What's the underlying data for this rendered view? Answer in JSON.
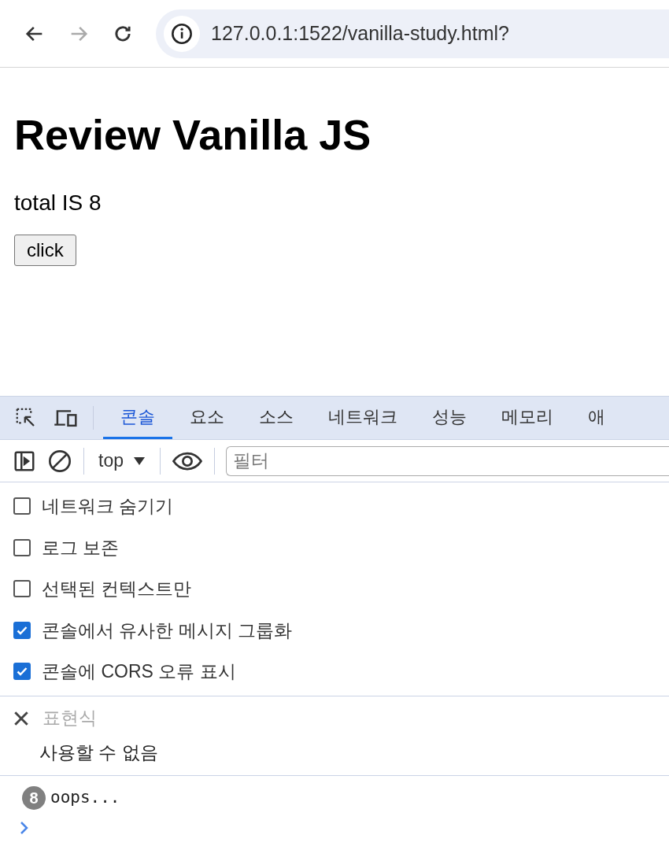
{
  "browser": {
    "url": "127.0.0.1:1522/vanilla-study.html?"
  },
  "page": {
    "heading": "Review Vanilla JS",
    "total_text": "total IS 8",
    "button": "click"
  },
  "devtools": {
    "tabs": [
      {
        "label": "콘솔",
        "selected": true
      },
      {
        "label": "요소",
        "selected": false
      },
      {
        "label": "소스",
        "selected": false
      },
      {
        "label": "네트워크",
        "selected": false
      },
      {
        "label": "성능",
        "selected": false
      },
      {
        "label": "메모리",
        "selected": false
      },
      {
        "label": "애",
        "selected": false
      }
    ],
    "context": "top",
    "filter": {
      "placeholder": "필터"
    },
    "settings": [
      {
        "label": "네트워크 숨기기",
        "checked": false
      },
      {
        "label": "로그 보존",
        "checked": false
      },
      {
        "label": "선택된 컨텍스트만",
        "checked": false
      },
      {
        "label": "콘솔에서 유사한 메시지 그룹화",
        "checked": true
      },
      {
        "label": "콘솔에 CORS 오류 표시",
        "checked": true
      }
    ],
    "live_expression": {
      "placeholder": "표현식",
      "value": "사용할 수 없음"
    },
    "messages": [
      {
        "count": "8",
        "text": "oops..."
      }
    ]
  }
}
